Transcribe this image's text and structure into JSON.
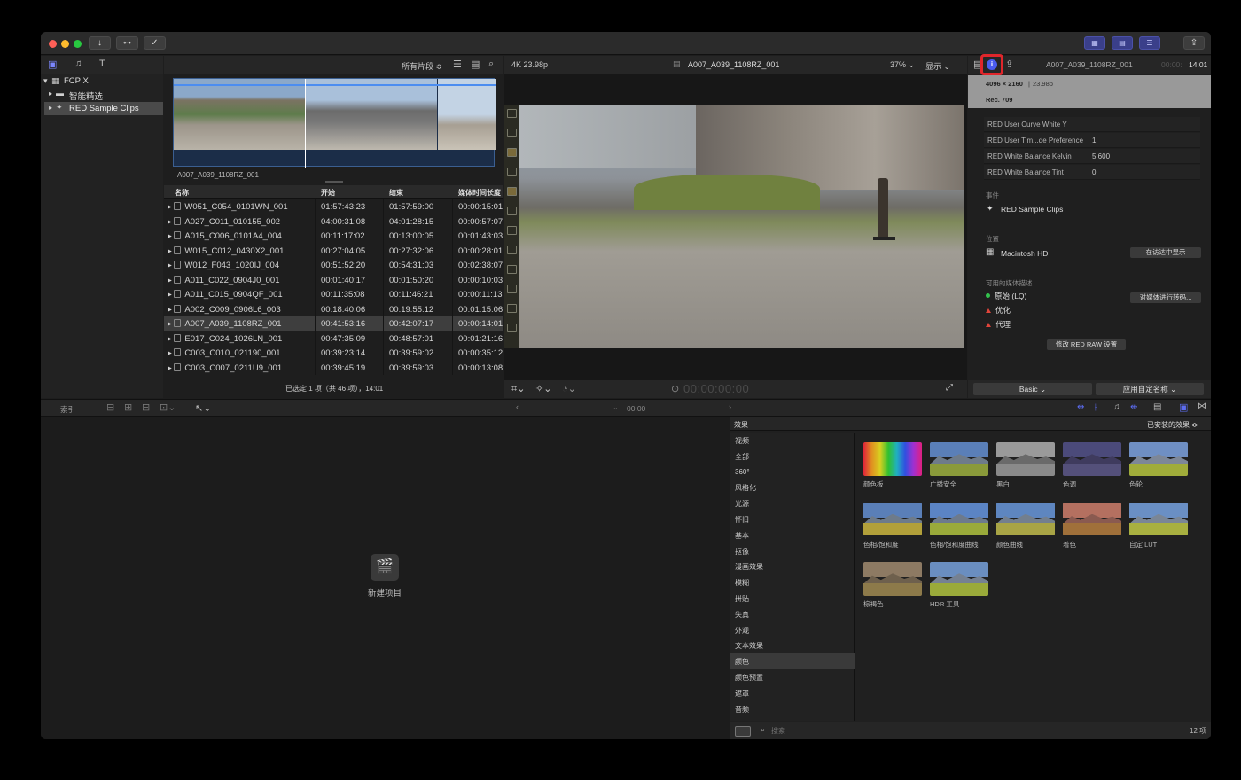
{
  "titlebar": {
    "import_icon": "download-icon",
    "keywords_icon": "key-icon",
    "bg_tasks_icon": "checkmark-circle-icon",
    "share_icon": "share-icon"
  },
  "browser": {
    "filter_label": "所有片段 ≎",
    "library": {
      "root": "FCP X",
      "items": [
        "智能精选",
        "RED Sample Clips"
      ]
    },
    "preview_caption": "A007_A039_1108RZ_001",
    "columns": [
      "名称",
      "开始",
      "结束",
      "媒体时间长度"
    ],
    "rows": [
      {
        "name": "W051_C054_0101WN_001",
        "start": "01:57:43:23",
        "end": "01:57:59:00",
        "duration": "00:00:15:01"
      },
      {
        "name": "A027_C011_010155_002",
        "start": "04:00:31:08",
        "end": "04:01:28:15",
        "duration": "00:00:57:07"
      },
      {
        "name": "A015_C006_0101A4_004",
        "start": "00:11:17:02",
        "end": "00:13:00:05",
        "duration": "00:01:43:03"
      },
      {
        "name": "W015_C012_0430X2_001",
        "start": "00:27:04:05",
        "end": "00:27:32:06",
        "duration": "00:00:28:01"
      },
      {
        "name": "W012_F043_1020IJ_004",
        "start": "00:51:52:20",
        "end": "00:54:31:03",
        "duration": "00:02:38:07"
      },
      {
        "name": "A011_C022_0904J0_001",
        "start": "00:01:40:17",
        "end": "00:01:50:20",
        "duration": "00:00:10:03"
      },
      {
        "name": "A011_C015_0904QF_001",
        "start": "00:11:35:08",
        "end": "00:11:46:21",
        "duration": "00:00:11:13"
      },
      {
        "name": "A002_C009_0906L6_003",
        "start": "00:18:40:06",
        "end": "00:19:55:12",
        "duration": "00:01:15:06"
      },
      {
        "name": "A007_A039_1108RZ_001",
        "start": "00:41:53:16",
        "end": "00:42:07:17",
        "duration": "00:00:14:01"
      },
      {
        "name": "E017_C024_1026LN_001",
        "start": "00:47:35:09",
        "end": "00:48:57:01",
        "duration": "00:01:21:16"
      },
      {
        "name": "C003_C010_021190_001",
        "start": "00:39:23:14",
        "end": "00:39:59:02",
        "duration": "00:00:35:12"
      },
      {
        "name": "C003_C007_0211U9_001",
        "start": "00:39:45:19",
        "end": "00:39:59:03",
        "duration": "00:00:13:08"
      }
    ],
    "selected_index": 8,
    "status": "已选定 1 项（共 46 项），14:01"
  },
  "viewer": {
    "format": "4K 23.98p",
    "clip_name": "A007_A039_1108RZ_001",
    "zoom": "37% ⌄",
    "display": "显示 ⌄",
    "timecode": "00:00:00:00"
  },
  "inspector": {
    "clip_name": "A007_A039_1108RZ_001",
    "duration_prefix": "00:00:",
    "duration": "14:01",
    "resolution": "4096 × 2160",
    "framerate": "23.98p",
    "colorspace": "Rec. 709",
    "props": [
      {
        "key": "RED User Curve White Y",
        "value": ""
      },
      {
        "key": "RED User Tim...de Preference",
        "value": "1"
      },
      {
        "key": "RED White Balance Kelvin",
        "value": "5,600"
      },
      {
        "key": "RED White Balance Tint",
        "value": "0"
      }
    ],
    "event_label": "事件",
    "event_value": "RED Sample Clips",
    "location_label": "位置",
    "location_value": "Macintosh HD",
    "reveal_button": "在访达中显示",
    "media_label": "可用的媒体描述",
    "media_items": [
      {
        "label": "原始 (LQ)",
        "status": "ok"
      },
      {
        "label": "优化",
        "status": "missing"
      },
      {
        "label": "代理",
        "status": "missing"
      }
    ],
    "transcode_button": "对媒体进行转码...",
    "raw_button": "修改 RED RAW 设置",
    "basic_button": "Basic ⌄",
    "apply_button": "应用自定名称 ⌄"
  },
  "timeline": {
    "index_label": "索引",
    "timecode": "00:00",
    "empty_label": "新建项目"
  },
  "effects": {
    "header": "效果",
    "installed": "已安装的效果 ≎",
    "categories": [
      "视频",
      "全部",
      "360°",
      "风格化",
      "光源",
      "怀旧",
      "基本",
      "抠像",
      "漫画效果",
      "模糊",
      "拼贴",
      "失真",
      "外观",
      "文本效果",
      "颜色",
      "颜色预置",
      "遮罩",
      "音频"
    ],
    "selected_category": "颜色",
    "items": [
      "颜色板",
      "广播安全",
      "黑白",
      "色调",
      "色轮",
      "色相/饱和度",
      "色相/饱和度曲线",
      "颜色曲线",
      "着色",
      "自定 LUT",
      "棕褐色",
      "HDR 工具"
    ],
    "search_placeholder": "搜索",
    "count": "12 项"
  }
}
